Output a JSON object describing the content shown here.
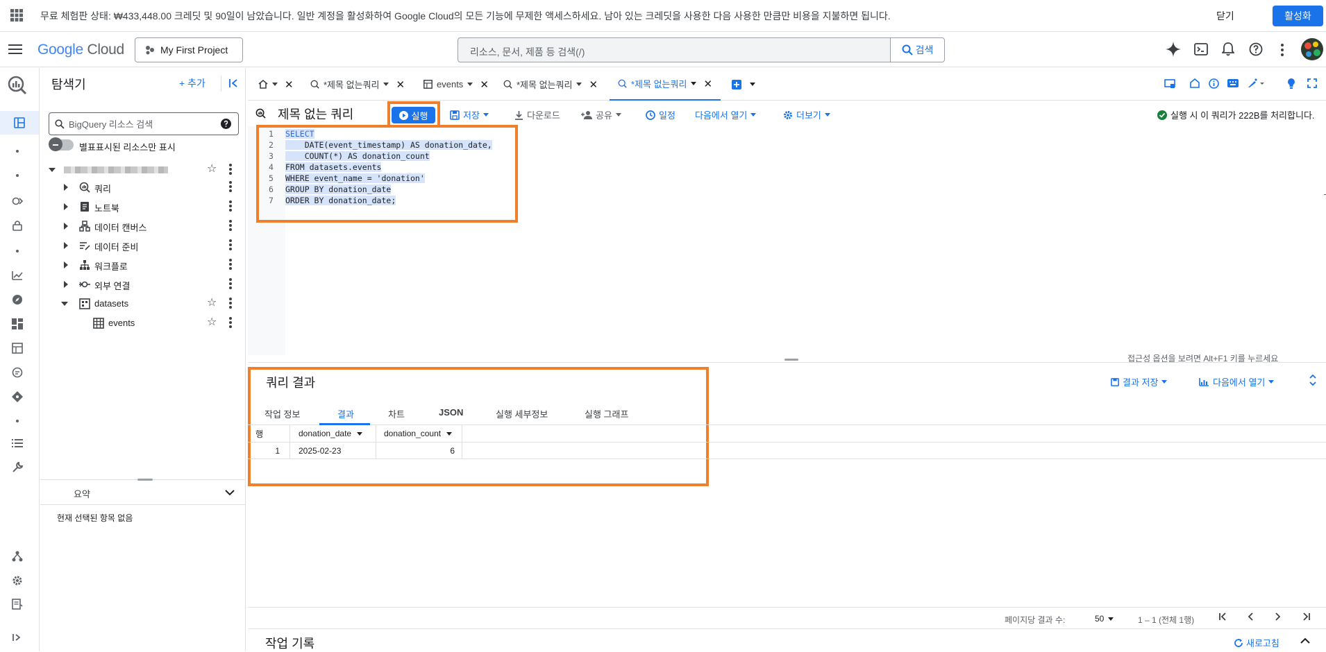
{
  "banner": {
    "message": "무료 체험판 상태: ₩433,448.00 크레딧 및 90일이 남았습니다. 일반 계정을 활성화하여 Google Cloud의 모든 기능에 무제한 액세스하세요. 남아 있는 크레딧을 사용한 다음 사용한 만큼만 비용을 지불하면 됩니다.",
    "close_label": "닫기",
    "activate_label": "활성화"
  },
  "header": {
    "logo_google": "Google",
    "logo_cloud": "Cloud",
    "project": "My First Project",
    "search_placeholder": "리소스, 문서, 제품 등 검색(/)",
    "search_button": "검색"
  },
  "explorer": {
    "title": "탐색기",
    "add_label": "+ 추가",
    "search_placeholder": "BigQuery 리소스 검색",
    "toggle_label": "별표표시된 리소스만 표시",
    "items": [
      {
        "label": "쿼리",
        "icon": "query-icon"
      },
      {
        "label": "노트북",
        "icon": "notebook-icon"
      },
      {
        "label": "데이터 캔버스",
        "icon": "canvas-icon"
      },
      {
        "label": "데이터 준비",
        "icon": "data-prep-icon"
      },
      {
        "label": "워크플로",
        "icon": "workflow-icon"
      },
      {
        "label": "외부 연결",
        "icon": "connection-icon"
      },
      {
        "label": "datasets",
        "icon": "dataset-icon"
      },
      {
        "label": "events",
        "icon": "table-icon"
      }
    ],
    "summary_label": "요약",
    "no_selection": "현재 선택된 항목 없음"
  },
  "tabs": [
    {
      "label": "*제목 없는쿼리",
      "icon": "query-icon"
    },
    {
      "label": "events",
      "icon": "table-icon"
    },
    {
      "label": "*제목 없는쿼리",
      "icon": "query-icon"
    },
    {
      "label": "*제목 없는쿼리",
      "icon": "query-icon",
      "active": true
    }
  ],
  "toolbar": {
    "title": "제목 없는 쿼리",
    "run": "실행",
    "save": "저장",
    "download": "다운로드",
    "share": "공유",
    "schedule": "일정",
    "open_in": "다음에서 열기",
    "more": "더보기",
    "status": "실행 시 이 쿼리가 222B를 처리합니다."
  },
  "editor": {
    "line_numbers": [
      "1",
      "2",
      "3",
      "4",
      "5",
      "6",
      "7"
    ],
    "lines": [
      "SELECT",
      "    DATE(event_timestamp) AS donation_date,",
      "    COUNT(*) AS donation_count",
      "FROM datasets.events",
      "WHERE event_name = 'donation'",
      "GROUP BY donation_date",
      "ORDER BY donation_date;"
    ],
    "a11y_hint": "접근성 옵션을 보려면 Alt+F1 키를 누르세요"
  },
  "results": {
    "title": "쿼리 결과",
    "save_results": "결과 저장",
    "open_in": "다음에서 열기",
    "tabs": [
      "작업 정보",
      "결과",
      "차트",
      "JSON",
      "실행 세부정보",
      "실행 그래프"
    ],
    "row_header": "행",
    "columns": [
      "donation_date",
      "donation_count"
    ],
    "rows": [
      {
        "row": "1",
        "donation_date": "2025-02-23",
        "donation_count": "6"
      }
    ],
    "per_page_label": "페이지당 결과 수:",
    "per_page": "50",
    "range": "1 – 1 (전체 1행)",
    "history_title": "작업 기록",
    "refresh": "새로고침"
  },
  "colors": {
    "accent": "#1a73e8",
    "highlight_box": "#f07f2b",
    "success": "#188038"
  }
}
